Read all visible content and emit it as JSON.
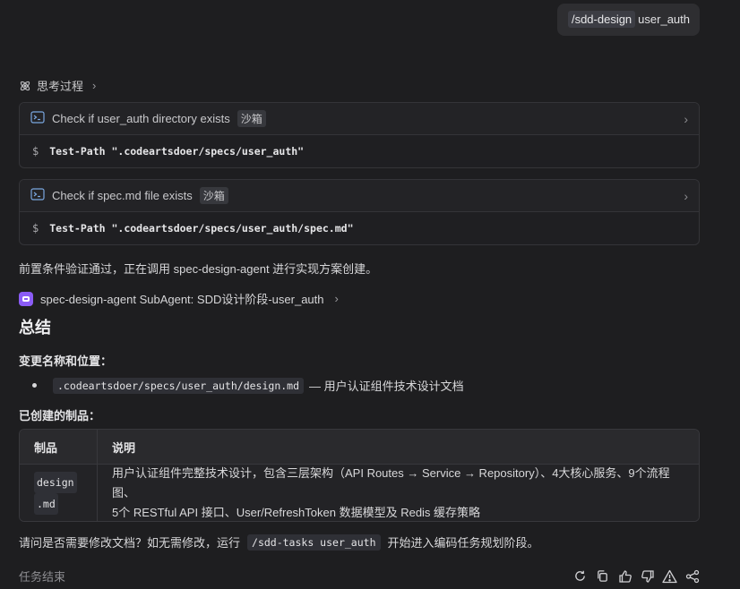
{
  "user_message": {
    "command": "/sdd-design",
    "argument": "user_auth"
  },
  "thinking": {
    "label": "思考过程"
  },
  "tool_calls": [
    {
      "title": "Check if user_auth directory exists",
      "badge": "沙箱",
      "prompt": "$",
      "command": "Test-Path \".codeartsdoer/specs/user_auth\""
    },
    {
      "title": "Check if spec.md file exists",
      "badge": "沙箱",
      "prompt": "$",
      "command": "Test-Path \".codeartsdoer/specs/user_auth/spec.md\""
    }
  ],
  "precheck_text": "前置条件验证通过，正在调用 spec-design-agent 进行实现方案创建。",
  "subagent": {
    "label": "spec-design-agent SubAgent: SDD设计阶段-user_auth"
  },
  "summary": {
    "heading": "总结",
    "change_label": "变更名称和位置：",
    "bullet_code": ".codeartsdoer/specs/user_auth/design.md",
    "bullet_text": "— 用户认证组件技术设计文档",
    "artifacts_label": "已创建的制品：",
    "table": {
      "headers": [
        "制品",
        "说明"
      ],
      "rows": [
        {
          "artifact_a": "design",
          "artifact_b": ".md",
          "desc_line1": "用户认证组件完整技术设计，包含三层架构（API Routes → Service → Repository）、4大核心服务、9个流程图、",
          "desc_line2": "5个 RESTful API 接口、User/RefreshToken 数据模型及 Redis 缓存策略"
        }
      ]
    },
    "final_prefix": "请问是否需要修改文档？如无需修改，运行",
    "final_code": "/sdd-tasks user_auth",
    "final_suffix": "开始进入编码任务规划阶段。"
  },
  "footer": {
    "status": "任务结束",
    "actions": [
      "retry-icon",
      "copy-icon",
      "thumbs-up-icon",
      "thumbs-down-icon",
      "warning-icon",
      "share-icon"
    ]
  }
}
